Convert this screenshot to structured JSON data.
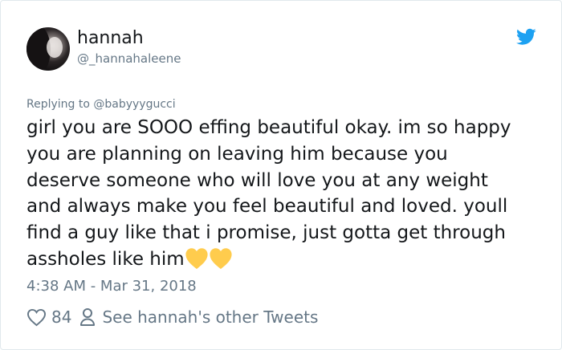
{
  "author": {
    "name": "hannah",
    "handle": "@_hannahaleene"
  },
  "reply": {
    "text": "Replying to @babyyygucci"
  },
  "tweet": {
    "lines": [
      "girl you are SOOO effing beautiful okay. im so happy",
      "you are planning on leaving him because you",
      "deserve someone who will love you at any weight",
      "and always make you feel beautiful and loved. youll",
      "find a guy like that i promise, just gotta get through",
      "assholes like him"
    ],
    "emoji": [
      "yellow-heart",
      "yellow-heart"
    ],
    "timestamp": "4:38 AM - Mar 31, 2018"
  },
  "actions": {
    "likes": "84",
    "see_other": "See hannah's other Tweets"
  },
  "colors": {
    "twitter_blue": "#1da1f2",
    "heart_yellow": "#ffcc4d",
    "text_dark": "#14171a",
    "text_muted": "#657786"
  },
  "icons": {
    "brand": "twitter-bird-icon",
    "like": "heart-outline-icon",
    "profile": "person-icon"
  }
}
